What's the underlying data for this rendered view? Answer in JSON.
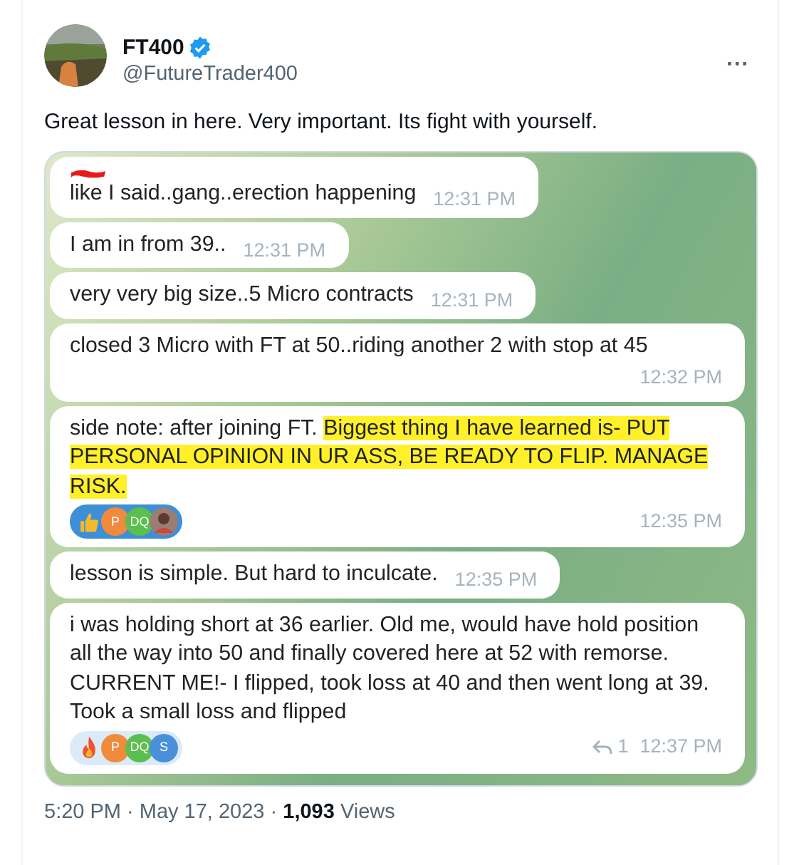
{
  "author": {
    "name": "FT400",
    "verified": true,
    "handle": "@FutureTrader400"
  },
  "more_label": "···",
  "tweet_text": "Great lesson in here. Very important.  Its fight with yourself.",
  "messages": [
    {
      "redacted": true,
      "segments": [
        {
          "text": "like I said..gang..erection happening",
          "highlighted": false
        }
      ],
      "time": "12:31 PM",
      "kind": "inline"
    },
    {
      "redacted": false,
      "segments": [
        {
          "text": "I am in from 39..",
          "highlighted": false
        }
      ],
      "time": "12:31 PM",
      "kind": "inline"
    },
    {
      "redacted": false,
      "segments": [
        {
          "text": "very very big size..5 Micro contracts",
          "highlighted": false
        }
      ],
      "time": "12:31 PM",
      "kind": "inline"
    },
    {
      "redacted": false,
      "segments": [
        {
          "text": "closed 3 Micro with FT at 50..riding another 2 with stop at 45",
          "highlighted": false
        }
      ],
      "time": "12:32 PM",
      "kind": "block"
    },
    {
      "redacted": false,
      "segments": [
        {
          "text": "side note: after joining FT. ",
          "highlighted": false
        },
        {
          "text": "Biggest thing I have learned is- PUT PERSONAL OPINION IN UR ASS, BE READY TO FLIP. MANAGE RISK.",
          "highlighted": true
        }
      ],
      "time": "12:35 PM",
      "kind": "block",
      "reaction": {
        "kind": "thumbs-up",
        "avatars": [
          {
            "initials": "P",
            "color": "#f08a3c"
          },
          {
            "initials": "DQ",
            "color": "#5bbf4f"
          },
          {
            "kind": "photo"
          }
        ]
      }
    },
    {
      "redacted": false,
      "segments": [
        {
          "text": "lesson is simple. But hard to inculcate.",
          "highlighted": false
        }
      ],
      "time": "12:35 PM",
      "kind": "inline"
    },
    {
      "redacted": false,
      "segments": [
        {
          "text": "i was holding short at 36 earlier. Old me, would have hold position all the way into 50 and finally covered here at 52 with remorse. CURRENT ME!- I flipped, took loss at 40 and then went long at 39. Took a small loss and flipped",
          "highlighted": false
        }
      ],
      "time": "12:37 PM",
      "kind": "block",
      "replies": "1",
      "reaction": {
        "kind": "fire",
        "avatars": [
          {
            "initials": "P",
            "color": "#f08a3c"
          },
          {
            "initials": "DQ",
            "color": "#5bbf4f"
          },
          {
            "initials": "S",
            "color": "#4a90d9"
          }
        ]
      }
    }
  ],
  "footer": "5:20 PM · May 17, 2023 · **1,093** Views"
}
